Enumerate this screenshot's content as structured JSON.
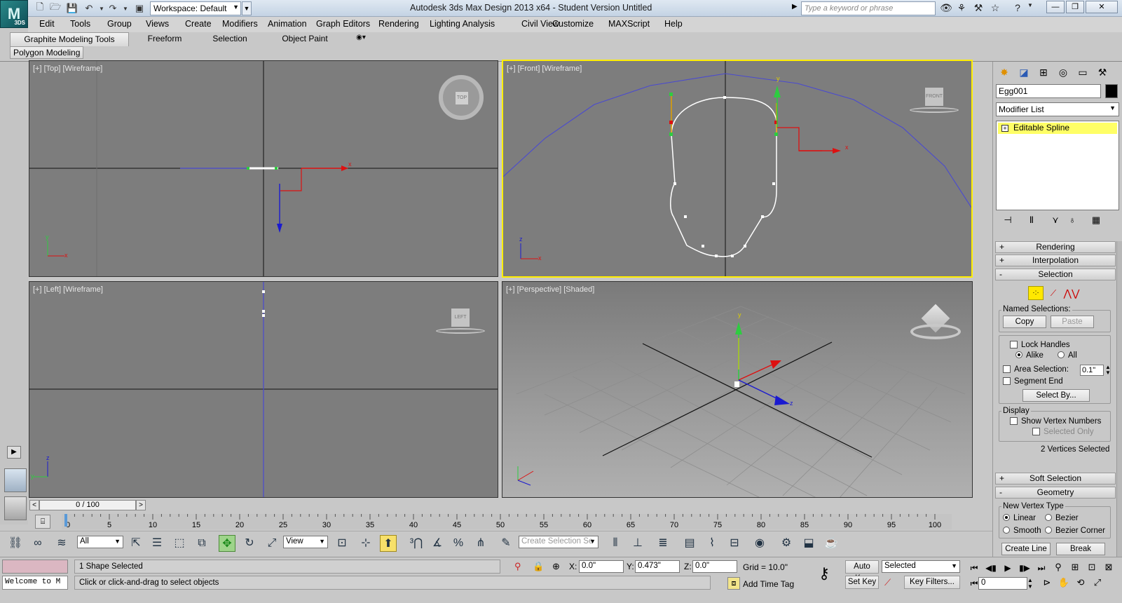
{
  "window": {
    "title": "Autodesk 3ds Max Design 2013 x64   - Student Version    Untitled",
    "logo_label": "M",
    "logo_sub": "3DS",
    "workspace": "Workspace: Default",
    "search_placeholder": "Type a keyword or phrase"
  },
  "menu": [
    "Edit",
    "Tools",
    "Group",
    "Views",
    "Create",
    "Modifiers",
    "Animation",
    "Graph Editors",
    "Rendering",
    "Lighting Analysis",
    "Civil View",
    "Customize",
    "MAXScript",
    "Help"
  ],
  "ribbon": {
    "tabs": [
      "Graphite Modeling Tools",
      "Freeform",
      "Selection",
      "Object Paint"
    ],
    "panel": "Polygon Modeling"
  },
  "viewports": {
    "top": {
      "label": "[+] [Top] [Wireframe]",
      "cube": "TOP"
    },
    "front": {
      "label": "[+] [Front] [Wireframe]",
      "cube": "FRONT"
    },
    "left": {
      "label": "[+] [Left] [Wireframe]",
      "cube": "LEFT"
    },
    "perspective": {
      "label": "[+] [Perspective] [Shaded]"
    }
  },
  "command_panel": {
    "object_name": "Egg001",
    "object_color": "#000000",
    "modifier_list": "Modifier List",
    "stack_item": "Editable Spline",
    "rollouts": {
      "rendering": "Rendering",
      "interpolation": "Interpolation",
      "selection": "Selection",
      "soft_selection": "Soft Selection",
      "geometry": "Geometry"
    },
    "selection": {
      "named_selections": "Named Selections:",
      "copy": "Copy",
      "paste": "Paste",
      "lock_handles": "Lock Handles",
      "alike": "Alike",
      "all": "All",
      "area_selection": "Area Selection:",
      "area_value": "0.1\"",
      "segment_end": "Segment End",
      "select_by": "Select By...",
      "display": "Display",
      "show_vertex_numbers": "Show Vertex Numbers",
      "selected_only": "Selected Only",
      "status": "2 Vertices Selected"
    },
    "geometry": {
      "new_vertex_type": "New Vertex Type",
      "linear": "Linear",
      "bezier": "Bezier",
      "smooth": "Smooth",
      "bezier_corner": "Bezier Corner",
      "create_line": "Create Line",
      "break": "Break"
    }
  },
  "timeline": {
    "slider": "0 / 100",
    "ticks": [
      "0",
      "5",
      "10",
      "15",
      "20",
      "25",
      "30",
      "35",
      "40",
      "45",
      "50",
      "55",
      "60",
      "65",
      "70",
      "75",
      "80",
      "85",
      "90",
      "95",
      "100"
    ]
  },
  "toolbar": {
    "filter": "All",
    "ref_coord": "View",
    "named_sel_placeholder": "Create Selection Se"
  },
  "status": {
    "maxscript": "Welcome to M",
    "selected": "1 Shape Selected",
    "prompt": "Click or click-and-drag to select objects",
    "x_label": "X:",
    "x": "0.0\"",
    "y_label": "Y:",
    "y": "0.473\"",
    "z_label": "Z:",
    "z": "0.0\"",
    "grid": "Grid = 10.0\"",
    "add_time_tag": "Add Time Tag",
    "auto_key": "Auto Key",
    "set_key": "Set Key",
    "key_mode": "Selected",
    "key_filters": "Key Filters...",
    "frame": "0"
  }
}
